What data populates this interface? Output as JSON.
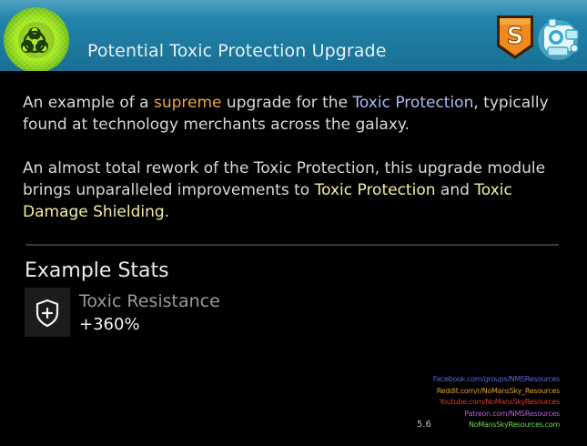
{
  "header": {
    "title": "Potential Toxic Protection Upgrade",
    "icon": "biohazard-icon",
    "class_badge": "S",
    "companion_icon": "robot-icon"
  },
  "description": {
    "p1": {
      "before": "An example of a ",
      "class_word": "supreme",
      "middle": " upgrade for the ",
      "tech": "Toxic Protection",
      "after": ", typically found at technology merchants across the galaxy."
    },
    "p2": {
      "before": "An almost total rework of the Toxic Protection, this upgrade module brings unparalleled improvements to ",
      "stat1": "Toxic Protection",
      "and": " and ",
      "stat2": "Toxic Damage Shielding",
      "end": "."
    }
  },
  "stats": {
    "heading": "Example Stats",
    "items": [
      {
        "name": "Toxic Resistance",
        "value": "+360%",
        "icon": "shield-plus-icon"
      }
    ]
  },
  "credits": {
    "facebook": "Facebook.com/groups/NMSResources",
    "reddit": "Reddit.com/r/NoMansSky_Resources",
    "youtube": "Youtube.com/NoMansSkyResources",
    "patreon": "Patreon.com/NMSResources",
    "website": "NoMansSkyResources.com",
    "version": "5.6"
  },
  "colors": {
    "header": "#1f7ea5",
    "supreme": "#f0a43a",
    "tech_link": "#a9bdf5",
    "stat_highlight": "#f2ee9e",
    "badge": "#f08a1c"
  }
}
